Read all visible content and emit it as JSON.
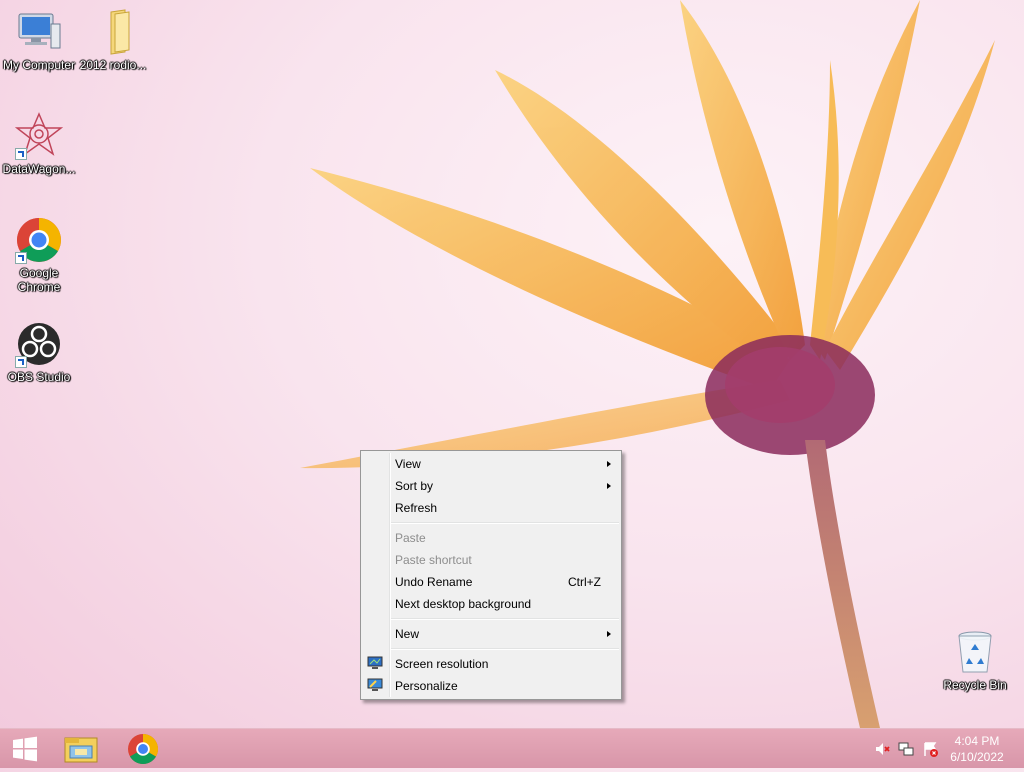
{
  "desktop": {
    "icons": [
      {
        "label": "My Computer",
        "icon": "computer-icon"
      },
      {
        "label": "2012 rodio...",
        "icon": "folder-icon"
      },
      {
        "label": "DataWagon...",
        "icon": "datawagon-icon"
      },
      {
        "label": "Google Chrome",
        "icon": "chrome-icon"
      },
      {
        "label": "OBS Studio",
        "icon": "obs-icon"
      },
      {
        "label": "Recycle Bin",
        "icon": "recycle-bin-icon"
      }
    ]
  },
  "context_menu": {
    "items": [
      {
        "label": "View",
        "submenu": true,
        "enabled": true
      },
      {
        "label": "Sort by",
        "submenu": true,
        "enabled": true
      },
      {
        "label": "Refresh",
        "enabled": true
      },
      {
        "label": "Paste",
        "enabled": false
      },
      {
        "label": "Paste shortcut",
        "enabled": false
      },
      {
        "label": "Undo Rename",
        "shortcut": "Ctrl+Z",
        "enabled": true
      },
      {
        "label": "Next desktop background",
        "enabled": true
      },
      {
        "label": "New",
        "submenu": true,
        "enabled": true
      },
      {
        "label": "Screen resolution",
        "icon": "monitor-icon",
        "enabled": true
      },
      {
        "label": "Personalize",
        "icon": "personalize-icon",
        "enabled": true
      }
    ]
  },
  "taskbar": {
    "pinned": [
      "windows-logo-icon",
      "file-explorer-icon",
      "chrome-icon"
    ],
    "tray": [
      "volume-muted-icon",
      "network-icon",
      "action-center-icon"
    ],
    "clock": {
      "time": "4:04 PM",
      "date": "6/10/2022"
    }
  },
  "colors": {
    "taskbar": "#d896a9",
    "menu_bg": "#f0f0f0",
    "petal": "#f6a93a",
    "flower_center": "#8a2a5c"
  }
}
